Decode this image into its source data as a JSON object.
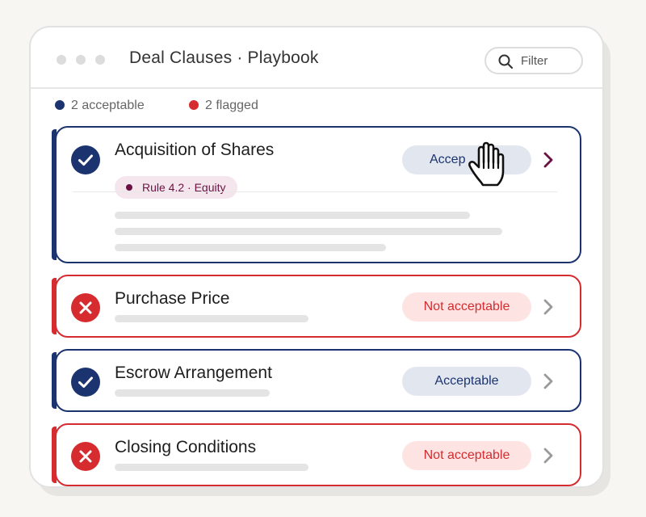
{
  "window": {
    "title": "Deal Clauses · Playbook",
    "filter_label": "Filter"
  },
  "summary": {
    "acceptable": "2 acceptable",
    "flagged": "2 flagged",
    "acceptable_color": "#1b3470",
    "flagged_color": "#d62b2f"
  },
  "clauses": [
    {
      "title": "Acquisition of Shares",
      "status": "Acceptable",
      "status_shown": "Accep",
      "state": "acceptable",
      "expanded": true,
      "rule": "Rule 4.2 · Equity",
      "icon": "check-circle-icon"
    },
    {
      "title": "Purchase Price",
      "status": "Not acceptable",
      "state": "not-acceptable",
      "icon": "x-circle-icon"
    },
    {
      "title": "Escrow Arrangement",
      "status": "Acceptable",
      "state": "acceptable",
      "icon": "check-circle-icon"
    },
    {
      "title": "Closing Conditions",
      "status": "Not acceptable",
      "state": "not-acceptable",
      "icon": "x-circle-icon"
    }
  ],
  "colors": {
    "acceptable": "#1b3470",
    "not_acceptable": "#d62b2f",
    "rule_accent": "#6b1242"
  },
  "icons": {
    "search": "search-icon",
    "chevron": "chevron-right-icon",
    "cursor": "hand-pointer-icon"
  }
}
